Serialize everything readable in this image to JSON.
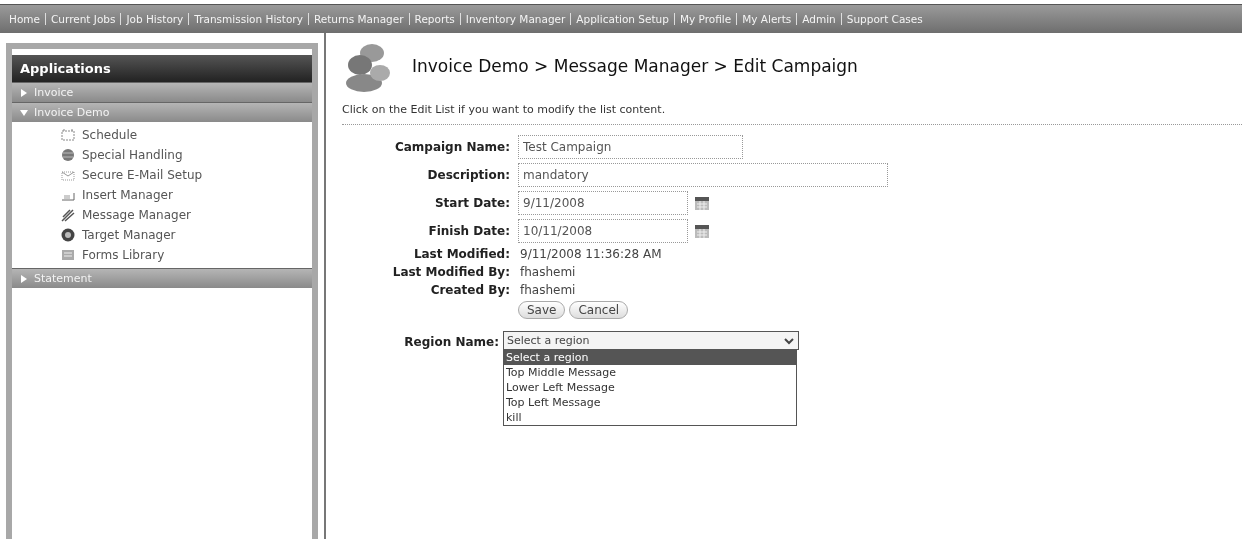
{
  "nav": [
    "Home",
    "Current Jobs",
    "Job History",
    "Transmission History",
    "Returns Manager",
    "Reports",
    "Inventory Manager",
    "Application Setup",
    "My Profile",
    "My Alerts",
    "Admin",
    "Support Cases"
  ],
  "sidebar": {
    "title": "Applications",
    "sections": [
      {
        "label": "Invoice",
        "expanded": false
      },
      {
        "label": "Invoice Demo",
        "expanded": true,
        "items": [
          {
            "label": "Schedule"
          },
          {
            "label": "Special Handling"
          },
          {
            "label": "Secure E-Mail Setup"
          },
          {
            "label": "Insert Manager"
          },
          {
            "label": "Message Manager"
          },
          {
            "label": "Target Manager"
          },
          {
            "label": "Forms Library"
          }
        ]
      },
      {
        "label": "Statement",
        "expanded": false
      }
    ]
  },
  "breadcrumb": "Invoice Demo > Message Manager > Edit Campaign",
  "instruction": "Click on the Edit List if you want to modify the list content.",
  "form": [
    {
      "kind": "input",
      "label": "Campaign Name:",
      "value": "Test Campaign"
    },
    {
      "kind": "wideinput",
      "label": "Description:",
      "value": "mandatory"
    },
    {
      "kind": "date",
      "label": "Start Date:",
      "value": "9/11/2008"
    },
    {
      "kind": "date",
      "label": "Finish Date:",
      "value": "10/11/2008"
    },
    {
      "kind": "text",
      "label": "Last Modified:",
      "value": "9/11/2008 11:36:28 AM"
    },
    {
      "kind": "text",
      "label": "Last Modified By:",
      "value": "fhashemi"
    },
    {
      "kind": "text",
      "label": "Created By:",
      "value": "fhashemi"
    }
  ],
  "buttons": [
    "Save",
    "Cancel"
  ],
  "region": {
    "label": "Region Name:",
    "value": "Select a region",
    "expanded": true,
    "options": [
      {
        "label": "Select a region",
        "selected": true
      },
      {
        "label": "Top Middle Message",
        "selected": false
      },
      {
        "label": "Lower Left Message",
        "selected": false
      },
      {
        "label": "Top Left Message",
        "selected": false
      },
      {
        "label": "kill",
        "selected": false
      }
    ]
  }
}
